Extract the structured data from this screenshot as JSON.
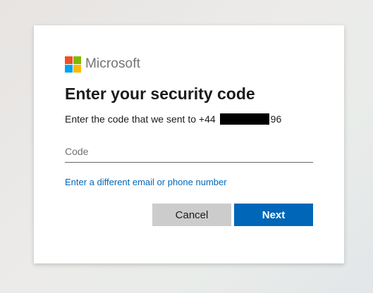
{
  "brand": {
    "name": "Microsoft",
    "logo_colors": [
      "#f25022",
      "#7fba00",
      "#00a4ef",
      "#ffb900"
    ]
  },
  "form": {
    "title": "Enter your security code",
    "description_prefix": "Enter the code that we sent to +44",
    "description_suffix": "96",
    "code_placeholder": "Code",
    "code_value": "",
    "alternate_link": "Enter a different email or phone number"
  },
  "buttons": {
    "cancel": "Cancel",
    "next": "Next"
  },
  "colors": {
    "accent": "#0067b8",
    "secondary_button": "#cccccc"
  }
}
